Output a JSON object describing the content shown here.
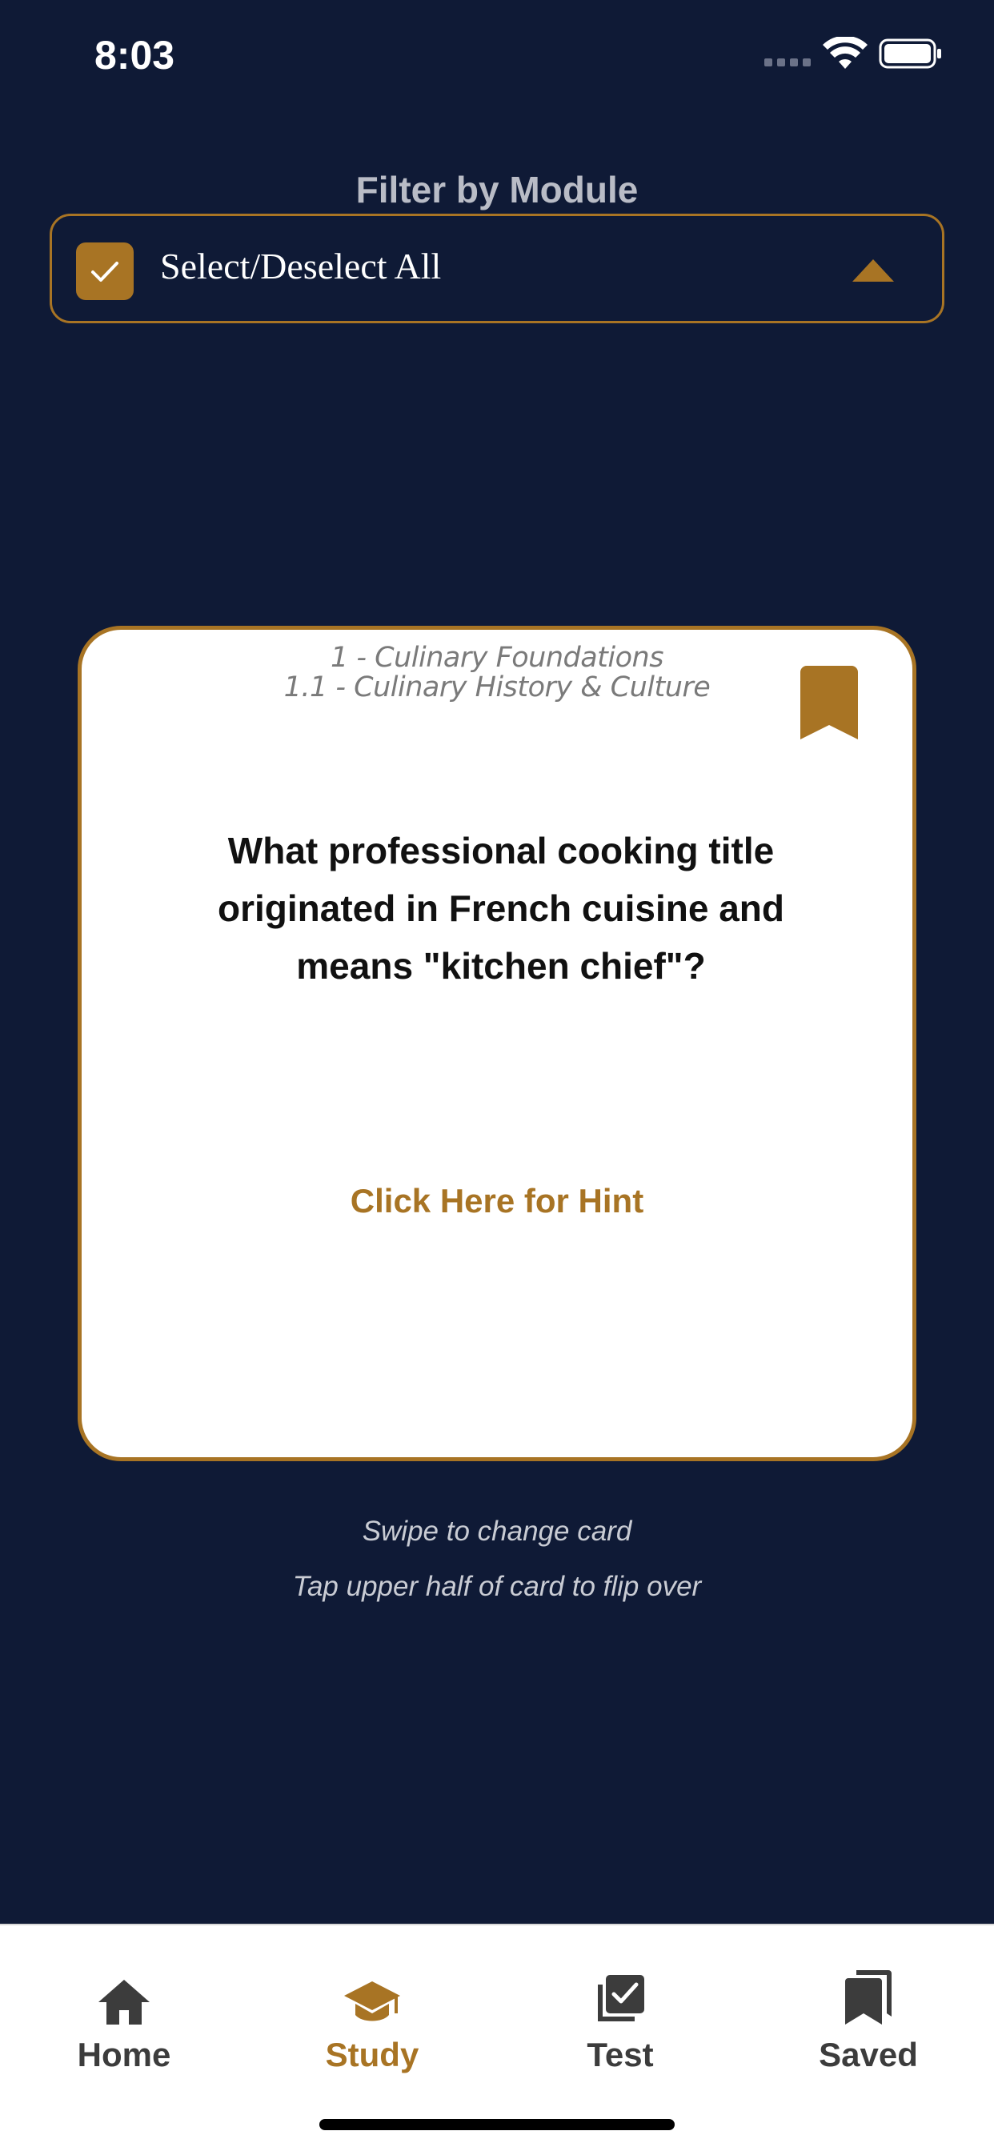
{
  "status_bar": {
    "time": "8:03"
  },
  "filter": {
    "label": "Filter by Module",
    "dropdown_text": "Select/Deselect All",
    "checked": true
  },
  "card": {
    "module": "1 - Culinary Foundations",
    "submodule": "1.1 - Culinary History & Culture",
    "question": "What professional cooking title originated in French cuisine and means \"kitchen chief\"?",
    "hint_label": "Click Here for Hint"
  },
  "instructions": {
    "swipe": "Swipe to change card",
    "tap": "Tap upper half of card to flip over"
  },
  "tabs": [
    {
      "label": "Home",
      "icon": "home-icon",
      "active": false
    },
    {
      "label": "Study",
      "icon": "graduation-cap-icon",
      "active": true
    },
    {
      "label": "Test",
      "icon": "checklist-icon",
      "active": false
    },
    {
      "label": "Saved",
      "icon": "bookmarks-icon",
      "active": false
    }
  ],
  "colors": {
    "background": "#0f1a36",
    "accent": "#a87424",
    "card": "#ffffff",
    "tab_inactive": "#3c3c3c"
  }
}
